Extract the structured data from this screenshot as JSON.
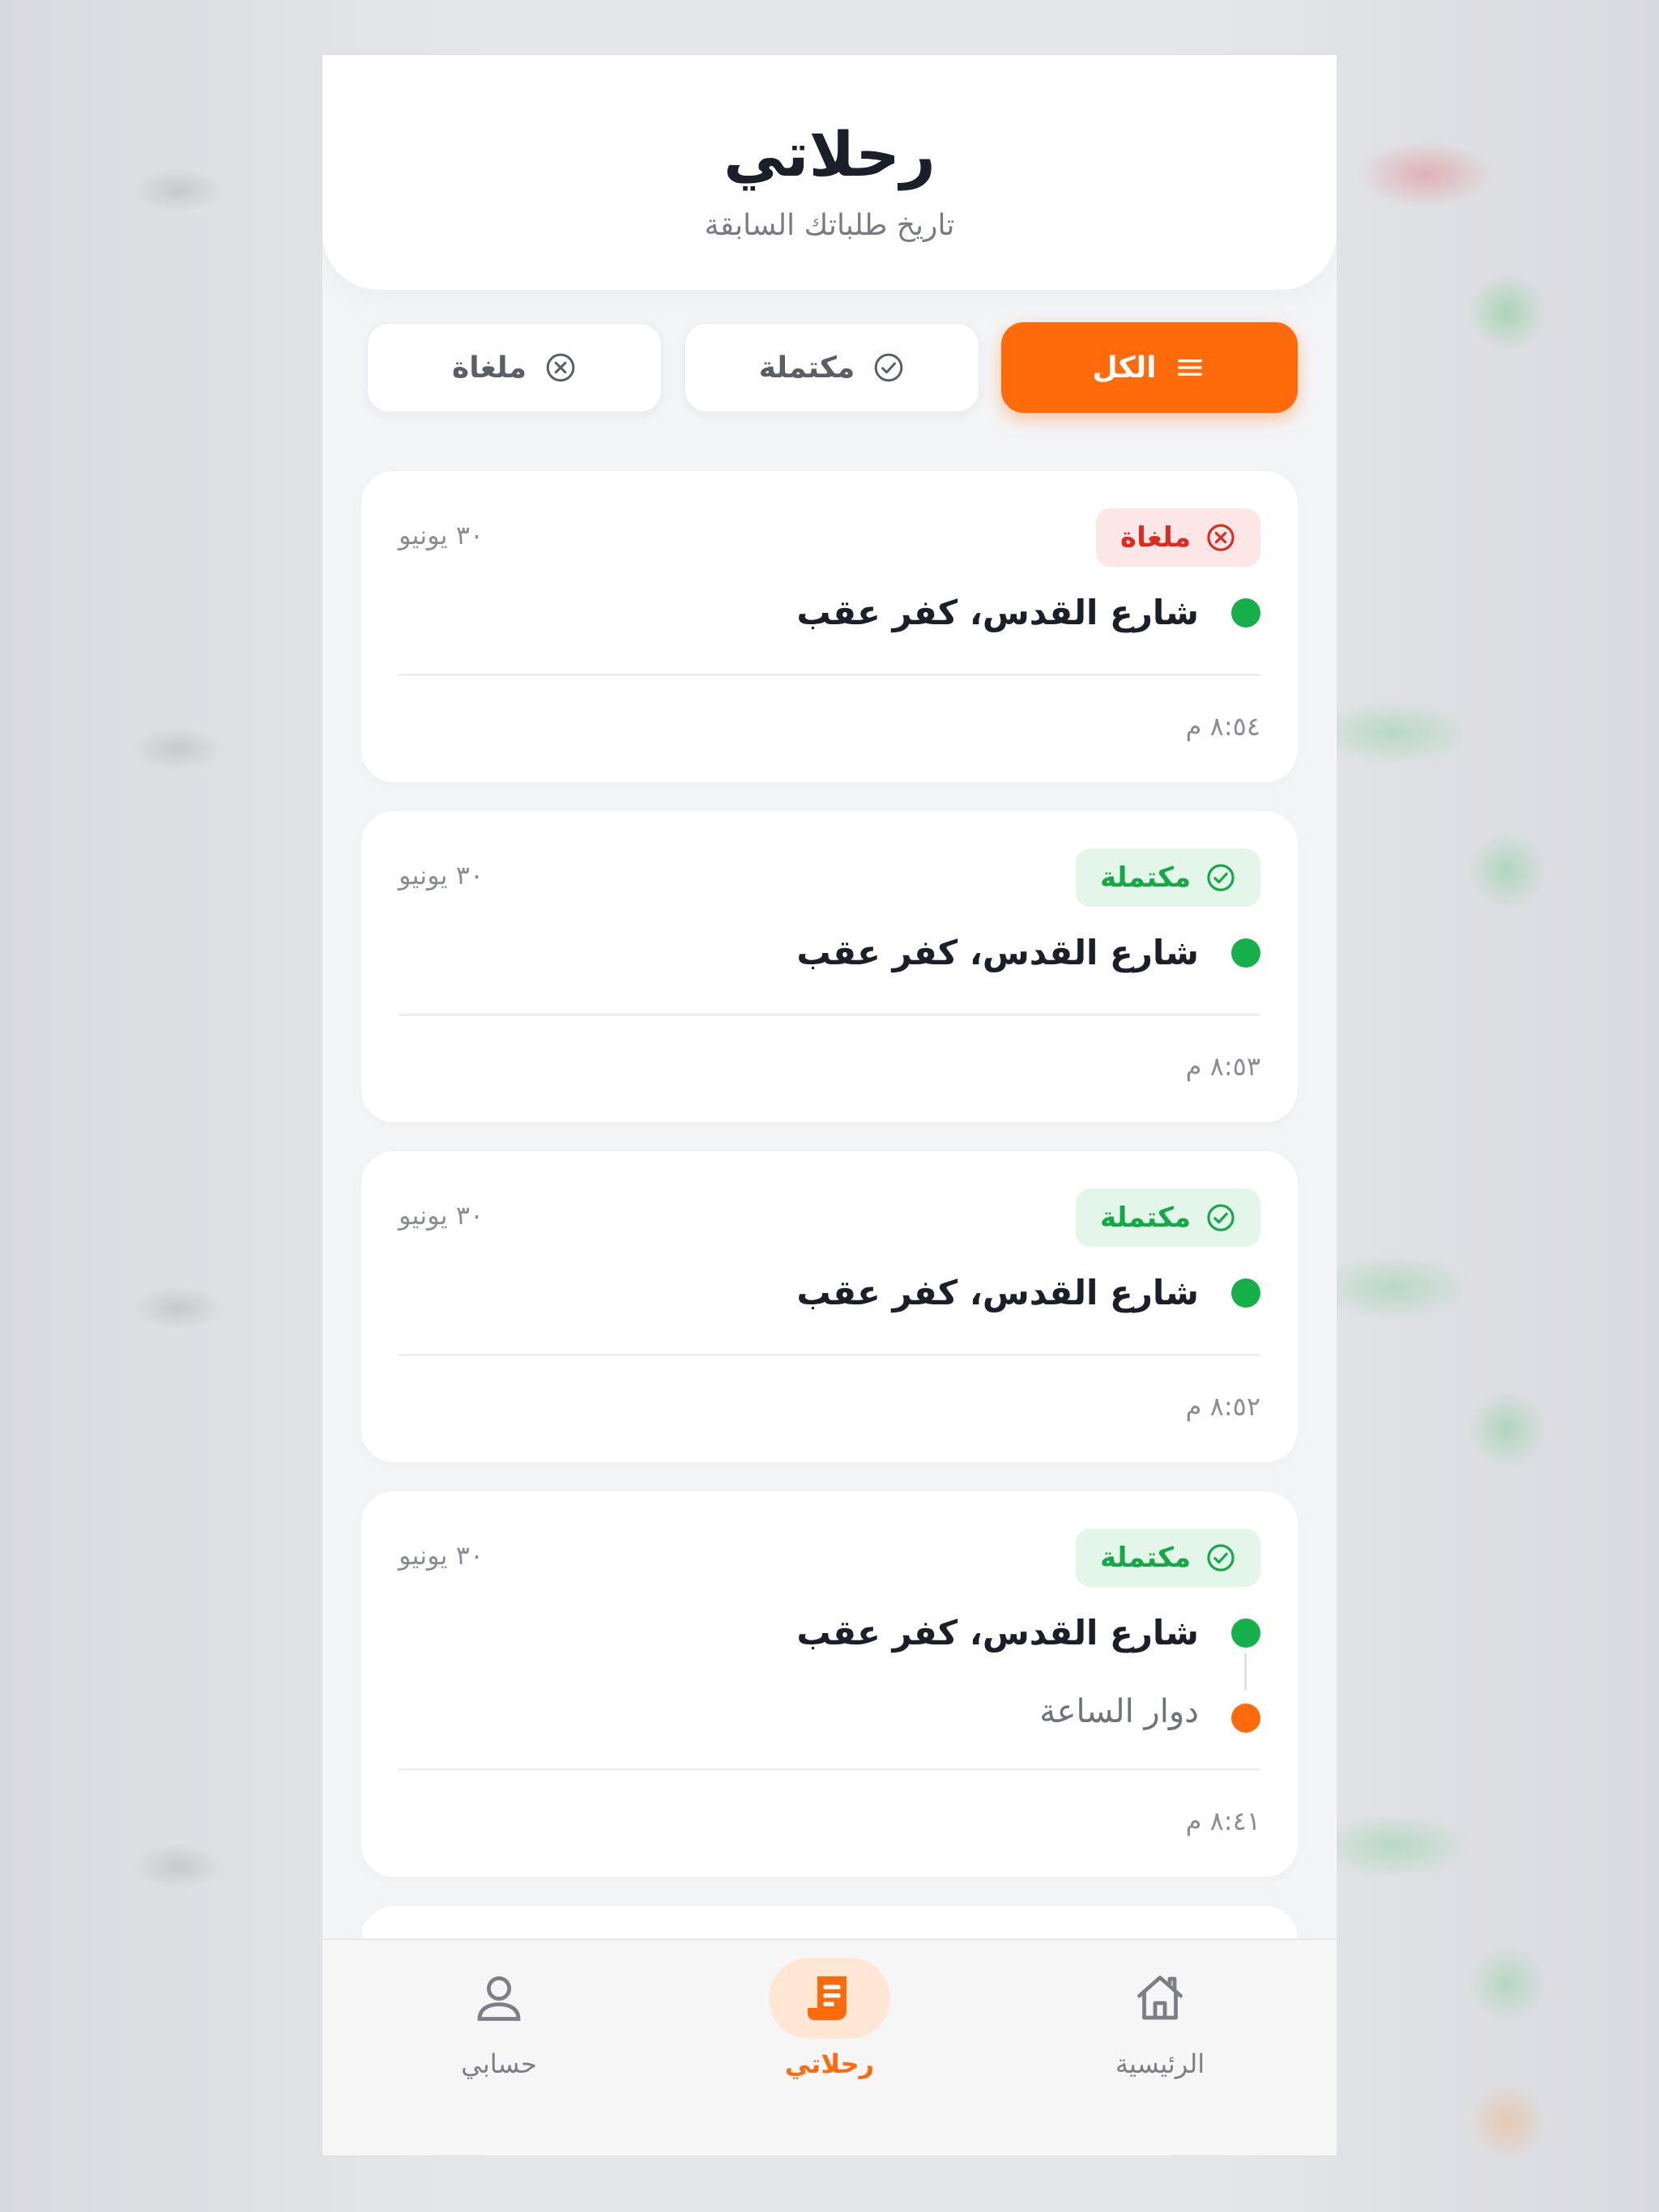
{
  "header": {
    "title": "رحلاتي",
    "subtitle": "تاريخ طلباتك السابقة"
  },
  "filters": [
    {
      "label": "الكل",
      "icon": "menu-icon",
      "active": true
    },
    {
      "label": "مكتملة",
      "icon": "check-circle-icon",
      "active": false
    },
    {
      "label": "ملغاة",
      "icon": "x-circle-icon",
      "active": false
    }
  ],
  "trips": [
    {
      "status": "ملغاة",
      "status_type": "cancelled",
      "date": "٣٠ يونيو",
      "pickup": "شارع القدس، كفر عقب",
      "dropoff": "",
      "time": "٨:٥٤ م"
    },
    {
      "status": "مكتملة",
      "status_type": "completed",
      "date": "٣٠ يونيو",
      "pickup": "شارع القدس، كفر عقب",
      "dropoff": "",
      "time": "٨:٥٣ م"
    },
    {
      "status": "مكتملة",
      "status_type": "completed",
      "date": "٣٠ يونيو",
      "pickup": "شارع القدس، كفر عقب",
      "dropoff": "",
      "time": "٨:٥٢ م"
    },
    {
      "status": "مكتملة",
      "status_type": "completed",
      "date": "٣٠ يونيو",
      "pickup": "شارع القدس، كفر عقب",
      "dropoff": "دوار الساعة",
      "time": "٨:٤١ م"
    }
  ],
  "nav": {
    "home": "الرئيسية",
    "trips": "رحلاتي",
    "account": "حسابي"
  },
  "colors": {
    "accent": "#ff6a0a",
    "completed": "#14a846",
    "cancelled": "#dc2b22",
    "pickup_dot": "#16b04a",
    "dropoff_dot": "#ff6a0a"
  }
}
